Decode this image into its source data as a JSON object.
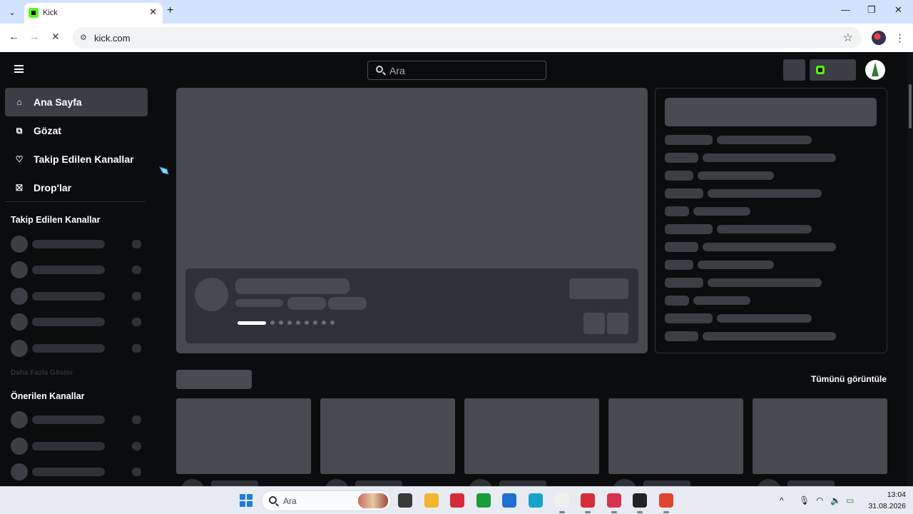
{
  "browser": {
    "tab_title": "Kick",
    "tab_close": "✕",
    "new_tab": "+",
    "tab_menu": "⌄",
    "back": "←",
    "forward": "→",
    "reload": "✕",
    "url": "kick.com",
    "bookmark_star": "☆",
    "menu": "⋮",
    "minimize": "—",
    "restore": "❐",
    "close": "✕"
  },
  "header": {
    "search_placeholder": "Ara"
  },
  "sidebar": {
    "nav": [
      {
        "label": "Ana Sayfa",
        "icon": "home-icon",
        "glyph": "⌂",
        "active": true
      },
      {
        "label": "Gözat",
        "icon": "browse-icon",
        "glyph": "⧉",
        "active": false
      },
      {
        "label": "Takip Edilen Kanallar",
        "icon": "heart-icon",
        "glyph": "♡",
        "active": false
      },
      {
        "label": "Drop'lar",
        "icon": "gift-icon",
        "glyph": "⛝",
        "active": false
      }
    ],
    "followed_title": "Takip Edilen Kanallar",
    "show_more": "Daha Fazla Göster",
    "recommended_title": "Önerilen Kanallar"
  },
  "main": {
    "view_all": "Tümünü görüntüle"
  },
  "taskbar": {
    "search_label": "Ara",
    "time": "13:04",
    "date": "31.08.2026",
    "tray_caret": "^",
    "apps": [
      {
        "name": "task-view-icon",
        "color": "#3a3a3a"
      },
      {
        "name": "file-explorer-icon",
        "color": "#f2b52c"
      },
      {
        "name": "app-red-icon",
        "color": "#d62b3a"
      },
      {
        "name": "xbox-icon",
        "color": "#1a9b3a"
      },
      {
        "name": "store-icon",
        "color": "#1f6fd1"
      },
      {
        "name": "edge-icon",
        "color": "#1aa3c9"
      },
      {
        "name": "app-document-icon",
        "color": "#eef2ea"
      },
      {
        "name": "app-red2-icon",
        "color": "#d62b3a"
      },
      {
        "name": "app-pink-icon",
        "color": "#d8324e"
      },
      {
        "name": "app-dark-icon",
        "color": "#222222"
      },
      {
        "name": "chrome-icon",
        "color": "#e0452f"
      }
    ]
  }
}
